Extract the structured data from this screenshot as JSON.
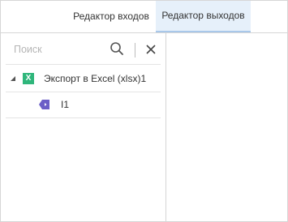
{
  "tabs": [
    {
      "label": "Редактор входов"
    },
    {
      "label": "Редактор выходов",
      "active": true
    }
  ],
  "search": {
    "placeholder": "Поиск",
    "value": ""
  },
  "tree": [
    {
      "label": "Экспорт в Excel (xlsx)1",
      "icon": "excel-icon",
      "expanded": true
    },
    {
      "label": "I1",
      "icon": "output-tag-icon"
    }
  ],
  "colors": {
    "excel": "#2fb67b",
    "tag": "#6b5fc7",
    "active_tab": "#e6f0fa"
  }
}
